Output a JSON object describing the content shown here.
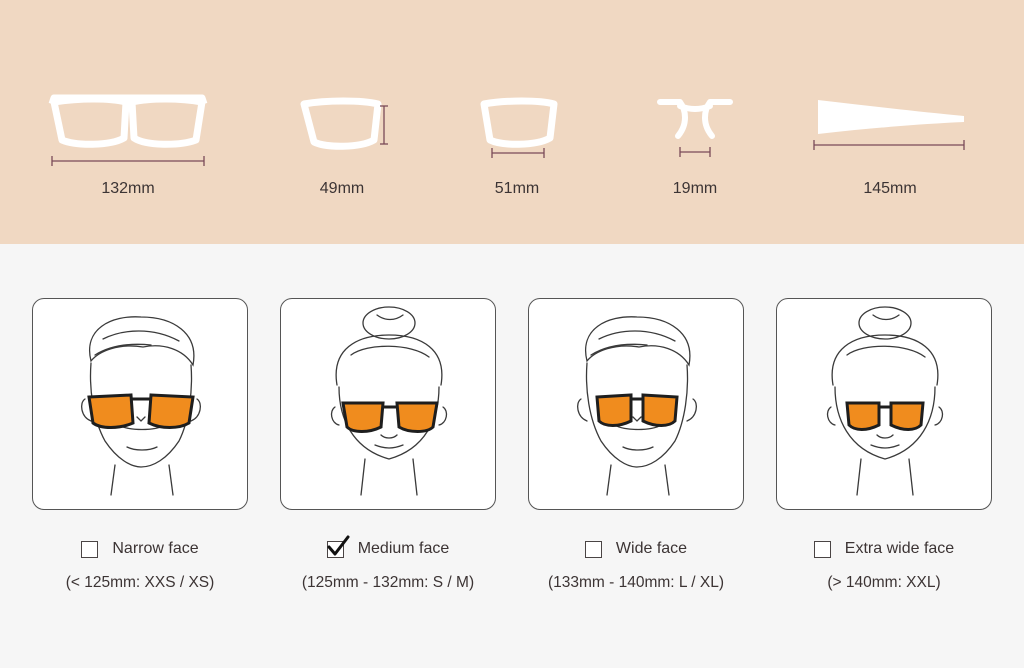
{
  "measurements": [
    {
      "label": "132mm",
      "icon": "frame-width-icon"
    },
    {
      "label": "49mm",
      "icon": "lens-height-icon"
    },
    {
      "label": "51mm",
      "icon": "lens-width-icon"
    },
    {
      "label": "19mm",
      "icon": "bridge-width-icon"
    },
    {
      "label": "145mm",
      "icon": "temple-length-icon"
    }
  ],
  "face_options": [
    {
      "label": "Narrow face",
      "range": "(< 125mm: XXS / XS)",
      "checked": false,
      "face": "male"
    },
    {
      "label": "Medium face",
      "range": "(125mm - 132mm: S / M)",
      "checked": true,
      "face": "female"
    },
    {
      "label": "Wide face",
      "range": "(133mm - 140mm: L / XL)",
      "checked": false,
      "face": "male"
    },
    {
      "label": "Extra wide face",
      "range": "(> 140mm: XXL)",
      "checked": false,
      "face": "female"
    }
  ],
  "colors": {
    "top_band": "#f0d8c2",
    "frame_outline": "#ffffff",
    "measure_line": "#7a4a58",
    "lens_orange": "#f08c1e",
    "frame_dark": "#1e1e1e"
  }
}
